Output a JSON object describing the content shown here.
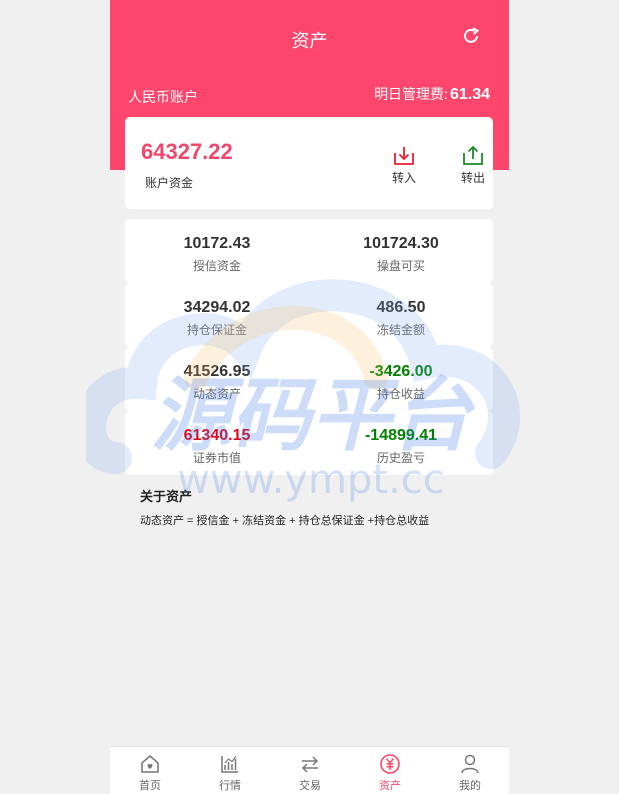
{
  "header": {
    "title": "资产",
    "account_label": "人民币账户",
    "fee_label": "明日管理费:",
    "fee_value": "61.34"
  },
  "balance": {
    "amount": "64327.22",
    "label": "账户资金",
    "transfer_in": "转入",
    "transfer_out": "转出"
  },
  "stats": [
    {
      "left": {
        "value": "10172.43",
        "label": "授信资金"
      },
      "right": {
        "value": "101724.30",
        "label": "操盘可买"
      }
    },
    {
      "left": {
        "value": "34294.02",
        "label": "持仓保证金"
      },
      "right": {
        "value": "486.50",
        "label": "冻结金额"
      }
    },
    {
      "left": {
        "value": "41526.95",
        "label": "动态资产"
      },
      "right": {
        "value": "-3426.00",
        "label": "持仓收益"
      }
    },
    {
      "left": {
        "value": "61340.15",
        "label": "证券市值"
      },
      "right": {
        "value": "-14899.41",
        "label": "历史盈亏"
      }
    }
  ],
  "about": {
    "title": "关于资产",
    "formula": "动态资产 = 授信金 + 冻结资金 + 持仓总保证金 +持仓总收益"
  },
  "watermark": {
    "text_cn": "源码平台",
    "text_en": "www.ympt.cc"
  },
  "colors": {
    "brand": "#fe456b",
    "positive": "#e00a1c",
    "negative": "#008000"
  },
  "tabbar": {
    "home": "首页",
    "market": "行情",
    "trade": "交易",
    "assets": "资产",
    "mine": "我的"
  }
}
